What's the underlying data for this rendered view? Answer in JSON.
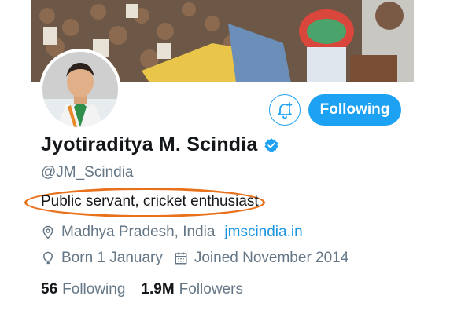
{
  "profile": {
    "name": "Jyotiraditya M. Scindia",
    "handle": "@JM_Scindia",
    "bio": "Public servant, cricket enthusiast",
    "location": "Madhya Pradesh, India",
    "website": "jmscindia.in",
    "birthday": "Born 1 January",
    "joined": "Joined November 2014",
    "following_count": "56",
    "following_label": "Following",
    "followers_count": "1.9M",
    "followers_label": "Followers"
  },
  "actions": {
    "follow_label": "Following"
  },
  "colors": {
    "accent": "#1da1f2",
    "link": "#1b95e0",
    "highlight": "#e8711c"
  },
  "icons": [
    "bell-plus-icon",
    "verified-badge-icon",
    "location-pin-icon",
    "balloon-icon",
    "calendar-icon"
  ]
}
